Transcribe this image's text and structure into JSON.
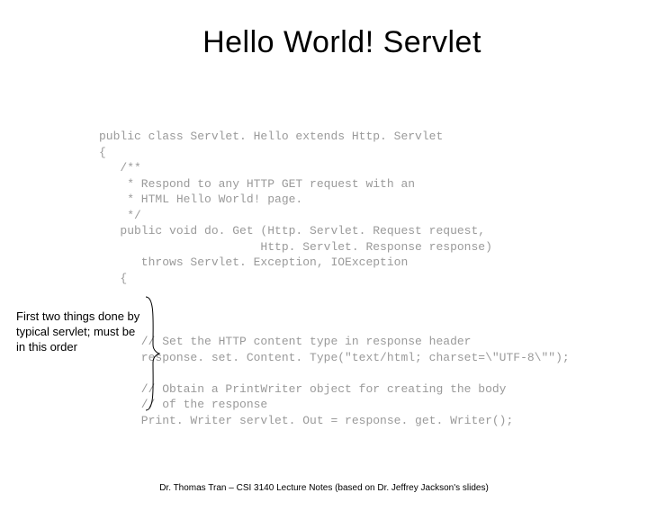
{
  "title": "Hello World! Servlet",
  "code": "public class Servlet. Hello extends Http. Servlet\n{\n   /**\n    * Respond to any HTTP GET request with an\n    * HTML Hello World! page.\n    */\n   public void do. Get (Http. Servlet. Request request,\n                       Http. Servlet. Response response)\n      throws Servlet. Exception, IOException\n   {\n\n\n\n      // Set the HTTP content type in response header\n      response. set. Content. Type(\"text/html; charset=\\\"UTF-8\\\"\");\n\n      // Obtain a PrintWriter object for creating the body\n      // of the response\n      Print. Writer servlet. Out = response. get. Writer();",
  "annotation": "First two things done by typical servlet; must be in this order",
  "footer": "Dr. Thomas Tran – CSI 3140 Lecture Notes (based on Dr. Jeffrey Jackson's slides)"
}
